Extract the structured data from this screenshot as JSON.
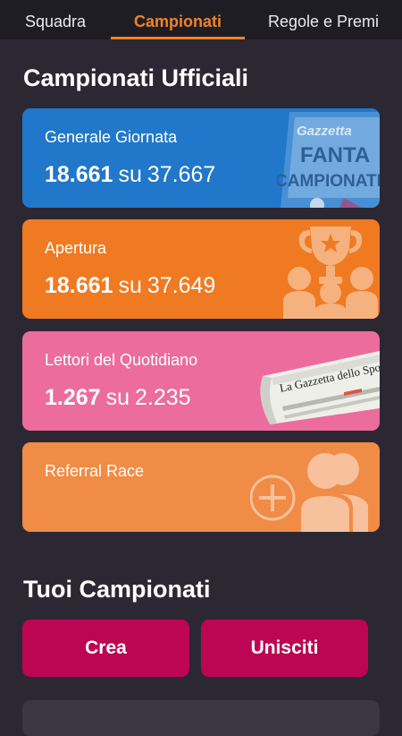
{
  "tabs": [
    {
      "label": "Squadra"
    },
    {
      "label": "Campionati"
    },
    {
      "label": "Regole e Premi"
    }
  ],
  "official": {
    "title": "Campionati Ufficiali",
    "cards": [
      {
        "name": "Generale Giornata",
        "position": "18.661",
        "separator": "su",
        "total": "37.667",
        "color": "#2177c9"
      },
      {
        "name": "Apertura",
        "position": "18.661",
        "separator": "su",
        "total": "37.649",
        "color": "#f07a21"
      },
      {
        "name": "Lettori del Quotidiano",
        "position": "1.267",
        "separator": "su",
        "total": "2.235",
        "color": "#ec6c9d"
      },
      {
        "name": "Referral Race",
        "color": "#f08c45"
      }
    ],
    "badge": {
      "line1": "Gazzetta",
      "line2": "FANTA",
      "line3": "CAMPIONATI"
    },
    "newspaper": {
      "masthead": "La Gazzetta dello Sport"
    }
  },
  "mine": {
    "title": "Tuoi Campionati",
    "create_label": "Crea",
    "join_label": "Unisciti"
  }
}
